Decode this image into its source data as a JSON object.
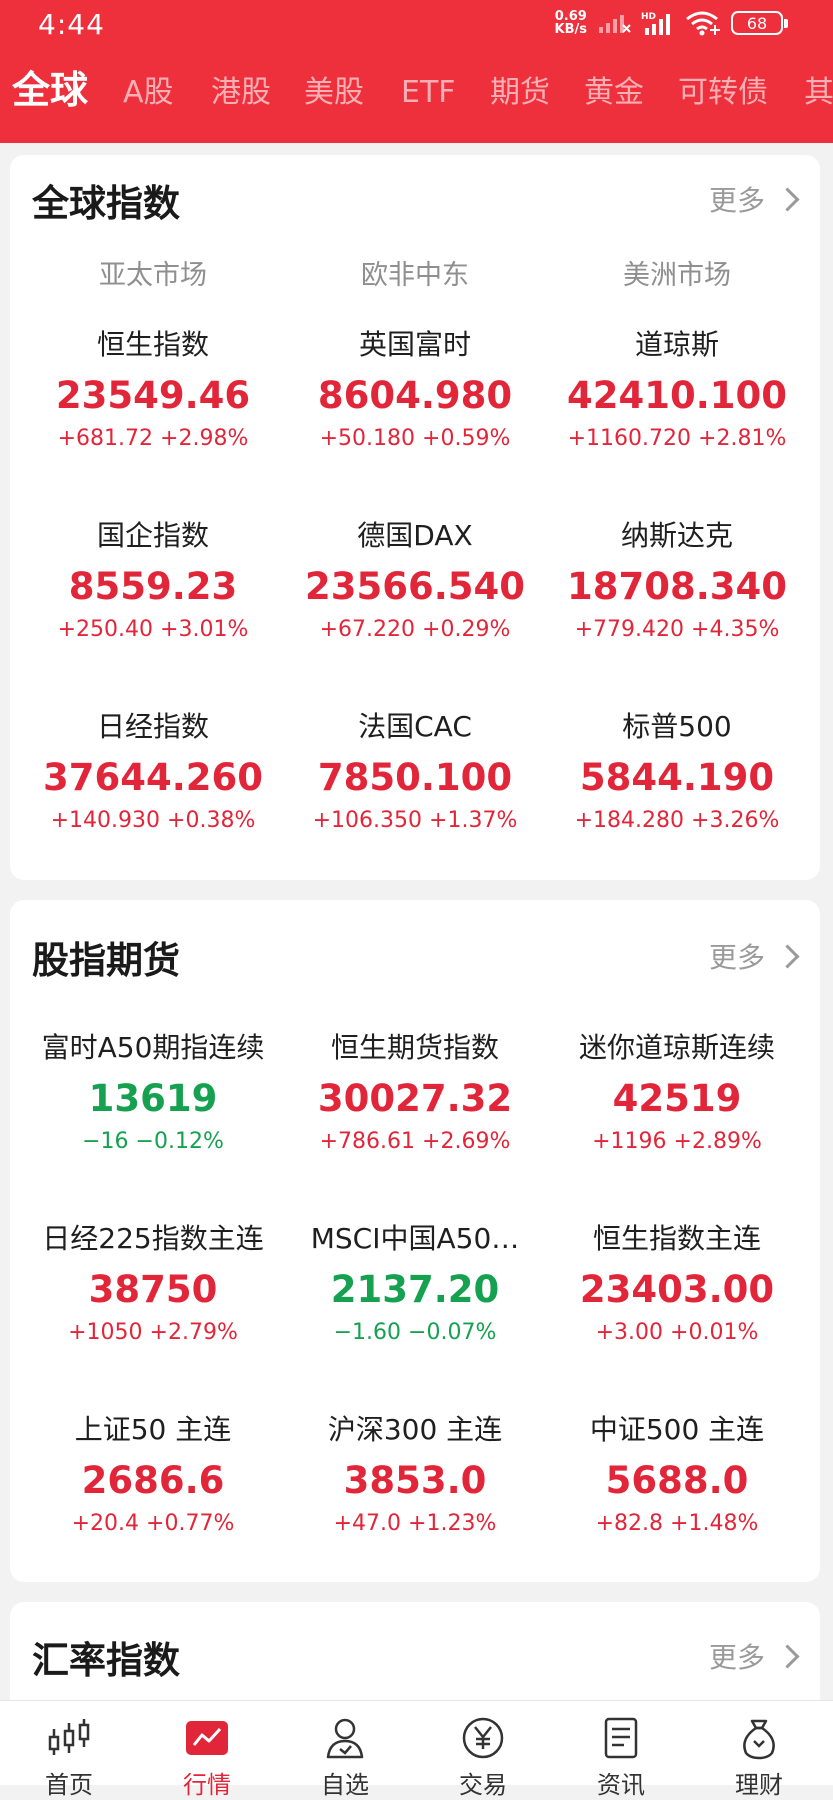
{
  "status_bar": {
    "time": "4:44",
    "net_speed_value": "0.69",
    "net_speed_unit": "KB/s",
    "battery": "68"
  },
  "tabs": [
    "全球",
    "A股",
    "港股",
    "美股",
    "ETF",
    "期货",
    "黄金",
    "可转债",
    "其"
  ],
  "global_indices": {
    "title": "全球指数",
    "more": "更多",
    "regions": [
      "亚太市场",
      "欧非中东",
      "美洲市场"
    ],
    "items": [
      {
        "name": "恒生指数",
        "value": "23549.46",
        "change": "+681.72 +2.98%",
        "trend": "up"
      },
      {
        "name": "英国富时",
        "value": "8604.980",
        "change": "+50.180 +0.59%",
        "trend": "up"
      },
      {
        "name": "道琼斯",
        "value": "42410.100",
        "change": "+1160.720 +2.81%",
        "trend": "up"
      },
      {
        "name": "国企指数",
        "value": "8559.23",
        "change": "+250.40 +3.01%",
        "trend": "up"
      },
      {
        "name": "德国DAX",
        "value": "23566.540",
        "change": "+67.220 +0.29%",
        "trend": "up"
      },
      {
        "name": "纳斯达克",
        "value": "18708.340",
        "change": "+779.420 +4.35%",
        "trend": "up"
      },
      {
        "name": "日经指数",
        "value": "37644.260",
        "change": "+140.930 +0.38%",
        "trend": "up"
      },
      {
        "name": "法国CAC",
        "value": "7850.100",
        "change": "+106.350 +1.37%",
        "trend": "up"
      },
      {
        "name": "标普500",
        "value": "5844.190",
        "change": "+184.280 +3.26%",
        "trend": "up"
      }
    ]
  },
  "index_futures": {
    "title": "股指期货",
    "more": "更多",
    "items": [
      {
        "name": "富时A50期指连续",
        "value": "13619",
        "change": "−16 −0.12%",
        "trend": "down"
      },
      {
        "name": "恒生期货指数",
        "value": "30027.32",
        "change": "+786.61 +2.69%",
        "trend": "up"
      },
      {
        "name": "迷你道琼斯连续",
        "value": "42519",
        "change": "+1196 +2.89%",
        "trend": "up"
      },
      {
        "name": "日经225指数主连",
        "value": "38750",
        "change": "+1050 +2.79%",
        "trend": "up"
      },
      {
        "name": "MSCI中国A50…",
        "value": "2137.20",
        "change": "−1.60 −0.07%",
        "trend": "down"
      },
      {
        "name": "恒生指数主连",
        "value": "23403.00",
        "change": "+3.00 +0.01%",
        "trend": "up"
      },
      {
        "name": "上证50 主连",
        "value": "2686.6",
        "change": "+20.4 +0.77%",
        "trend": "up"
      },
      {
        "name": "沪深300 主连",
        "value": "3853.0",
        "change": "+47.0 +1.23%",
        "trend": "up"
      },
      {
        "name": "中证500 主连",
        "value": "5688.0",
        "change": "+82.8 +1.48%",
        "trend": "up"
      }
    ]
  },
  "fx_index": {
    "title": "汇率指数",
    "more": "更多"
  },
  "bottom_nav": [
    {
      "label": "首页",
      "icon": "candlestick-icon"
    },
    {
      "label": "行情",
      "icon": "market-chart-icon"
    },
    {
      "label": "自选",
      "icon": "user-star-icon"
    },
    {
      "label": "交易",
      "icon": "yen-coin-icon"
    },
    {
      "label": "资讯",
      "icon": "news-document-icon"
    },
    {
      "label": "理财",
      "icon": "money-bag-icon"
    }
  ],
  "colors": {
    "brand_red": "#ee2f3c",
    "up": "#e2263a",
    "down": "#16a150"
  }
}
